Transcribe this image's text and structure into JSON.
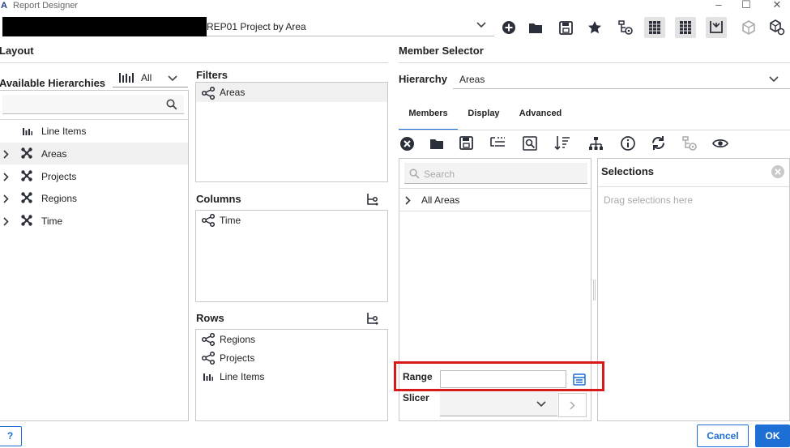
{
  "window": {
    "logo": "A",
    "title": "Report Designer"
  },
  "toolbar": {
    "report_name": "REP01 Project by Area",
    "icons": [
      "add-icon",
      "folder-icon",
      "save-icon",
      "star-icon",
      "hierarchy-settings-icon",
      "column-grid-icon",
      "row-grid-icon",
      "merge-down-icon",
      "cube-icon",
      "cube-settings-icon"
    ]
  },
  "layout": {
    "title": "Layout",
    "available_hierarchies_label": "Available Hierarchies",
    "hierarchy_filter_value": "All",
    "search_placeholder": "",
    "hierarchies": [
      {
        "label": "Line Items",
        "icon": "bar-chart-icon",
        "expandable": false,
        "selected": false
      },
      {
        "label": "Areas",
        "icon": "dimension-icon",
        "expandable": true,
        "selected": true
      },
      {
        "label": "Projects",
        "icon": "dimension-icon",
        "expandable": true,
        "selected": false
      },
      {
        "label": "Regions",
        "icon": "dimension-icon",
        "expandable": true,
        "selected": false
      },
      {
        "label": "Time",
        "icon": "dimension-icon",
        "expandable": true,
        "selected": false
      }
    ]
  },
  "filters": {
    "label": "Filters",
    "items": [
      "Areas"
    ]
  },
  "columns": {
    "label": "Columns",
    "items": [
      "Time"
    ]
  },
  "rows": {
    "label": "Rows",
    "items": [
      "Regions",
      "Projects",
      "Line Items"
    ]
  },
  "member_selector": {
    "title": "Member Selector",
    "hierarchy_label": "Hierarchy",
    "hierarchy_value": "Areas",
    "tabs": [
      "Members",
      "Display",
      "Advanced"
    ],
    "active_tab": "Members",
    "search_placeholder": "Search",
    "tree_items": [
      "All Areas"
    ],
    "selections_label": "Selections",
    "selections_placeholder": "Drag selections here",
    "range_label": "Range",
    "range_value": "",
    "slicer_label": "Slicer",
    "slicer_value": ""
  },
  "footer": {
    "help_label": "?",
    "cancel_label": "Cancel",
    "ok_label": "OK"
  },
  "colors": {
    "accent": "#1d6fd6",
    "highlight": "#d71b1b",
    "icon": "#2b2f3a"
  }
}
